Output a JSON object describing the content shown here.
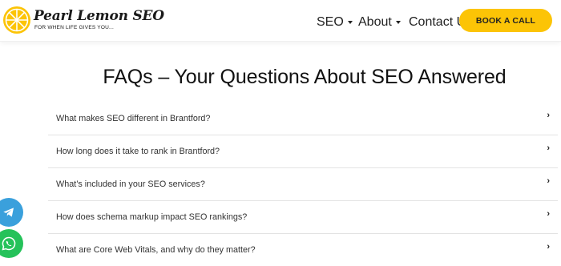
{
  "brand": {
    "name": "Pearl Lemon SEO",
    "tagline": "FOR WHEN LIFE GIVES YOU...",
    "accent": "#fcc406"
  },
  "nav": {
    "items": [
      {
        "label": "SEO",
        "has_dropdown": true
      },
      {
        "label": "About",
        "has_dropdown": true
      },
      {
        "label": "Contact Us",
        "has_dropdown": false
      }
    ],
    "cta_label": "BOOK A CALL"
  },
  "main": {
    "title": "FAQs – Your Questions About SEO Answered",
    "faqs": [
      {
        "question": "What makes SEO different in  Brantford?",
        "icon": "chevron-right-icon"
      },
      {
        "question": "How long does it take to rank in  Brantford?",
        "icon": "chevron-right-icon"
      },
      {
        "question": "What’s included in your SEO services?",
        "icon": "chevron-right-icon"
      },
      {
        "question": "How does schema markup impact SEO rankings?",
        "icon": "chevron-right-icon"
      },
      {
        "question": "What are Core Web Vitals, and why do they matter?",
        "icon": "chevron-right-icon"
      }
    ]
  },
  "floating": {
    "telegram_icon": "telegram-icon",
    "whatsapp_icon": "whatsapp-icon",
    "telegram_color": "#3aa0dc",
    "whatsapp_color": "#25c25a"
  }
}
